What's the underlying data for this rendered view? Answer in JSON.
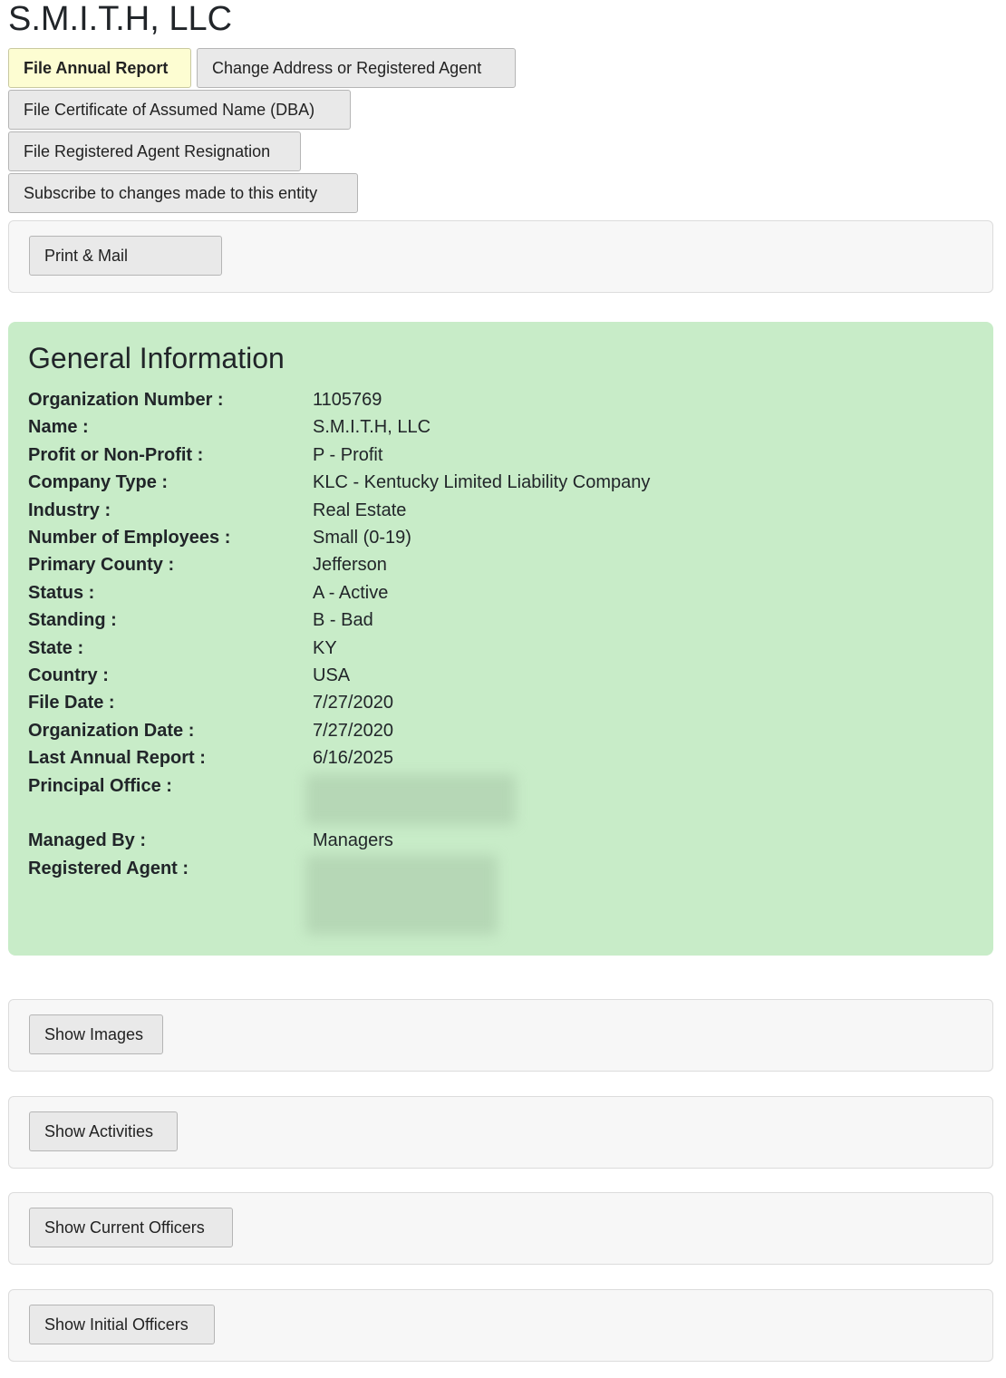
{
  "page": {
    "title": "S.M.I.T.H, LLC"
  },
  "actions": {
    "file_annual_report": "File Annual Report",
    "change_address": "Change Address or Registered Agent",
    "file_dba": "File Certificate of Assumed Name (DBA)",
    "file_agent_resignation": "File Registered Agent Resignation",
    "subscribe": "Subscribe to changes made to this entity"
  },
  "print_panel": {
    "button": "Print & Mail"
  },
  "general_info": {
    "heading": "General Information",
    "fields": [
      {
        "label": "Organization Number :",
        "value": "1105769"
      },
      {
        "label": "Name :",
        "value": "S.M.I.T.H, LLC"
      },
      {
        "label": "Profit or Non-Profit :",
        "value": "P - Profit"
      },
      {
        "label": "Company Type :",
        "value": "KLC - Kentucky Limited Liability Company"
      },
      {
        "label": "Industry :",
        "value": "Real Estate"
      },
      {
        "label": "Number of Employees :",
        "value": "Small (0-19)"
      },
      {
        "label": "Primary County :",
        "value": "Jefferson"
      },
      {
        "label": "Status :",
        "value": "A - Active"
      },
      {
        "label": "Standing :",
        "value": "B - Bad"
      },
      {
        "label": "State :",
        "value": "KY"
      },
      {
        "label": "Country :",
        "value": "USA"
      },
      {
        "label": "File Date :",
        "value": "7/27/2020"
      },
      {
        "label": "Organization Date :",
        "value": "7/27/2020"
      },
      {
        "label": "Last Annual Report :",
        "value": "6/16/2025"
      },
      {
        "label": "Principal Office :",
        "value": ""
      },
      {
        "label": "Managed By :",
        "value": "Managers"
      },
      {
        "label": "Registered Agent :",
        "value": ""
      }
    ]
  },
  "panels": {
    "show_images": "Show Images",
    "show_activities": "Show Activities",
    "show_current_officers": "Show Current Officers",
    "show_initial_officers": "Show Initial Officers"
  },
  "colors": {
    "info_background": "#c8ecc8",
    "primary_button_background": "#fdfdd2",
    "button_background": "#e9e9e9",
    "panel_background": "#f7f7f7"
  }
}
